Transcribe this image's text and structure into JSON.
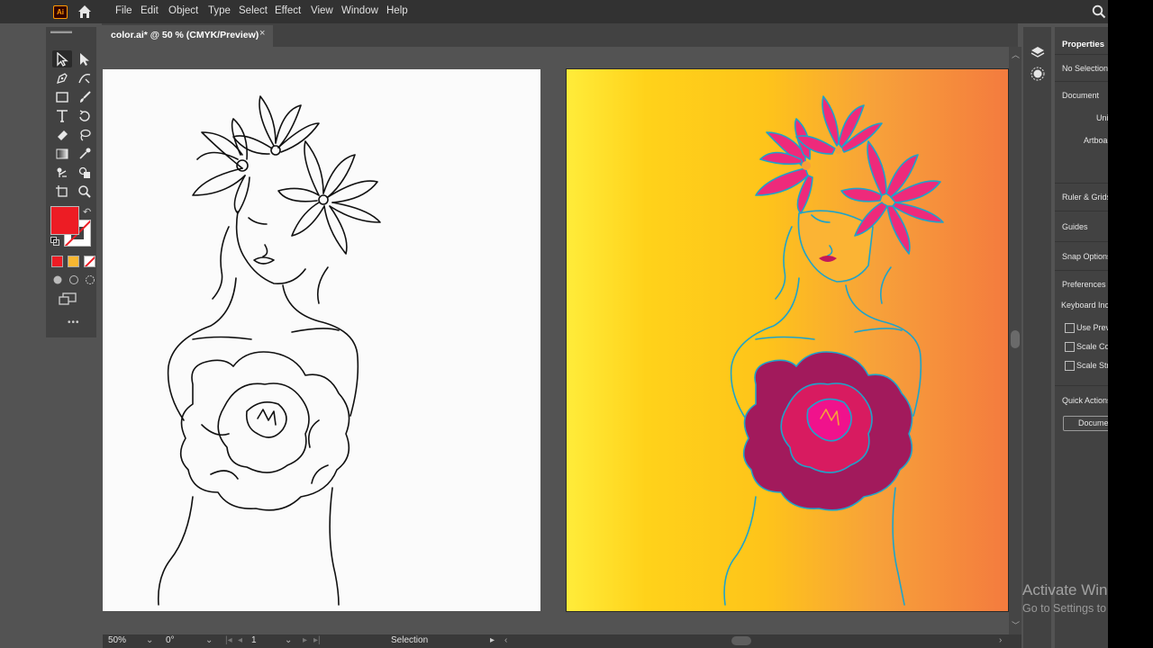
{
  "menubar": {
    "logo_text": "Ai",
    "items": [
      "File",
      "Edit",
      "Object",
      "Type",
      "Select",
      "Effect",
      "View",
      "Window",
      "Help"
    ]
  },
  "document_tab": {
    "title": "color.ai* @ 50 % (CMYK/Preview)",
    "close_glyph": "×"
  },
  "toolbar": {
    "tools": [
      "selection-tool",
      "direct-selection-tool",
      "pen-tool",
      "curvature-tool",
      "rectangle-tool",
      "paintbrush-tool",
      "type-tool",
      "rotate-tool",
      "eraser-tool",
      "lasso-tool",
      "gradient-tool",
      "eyedropper-tool",
      "puppet-warp-tool",
      "shape-builder-tool",
      "artboard-tool",
      "zoom-tool"
    ],
    "fill_color": "#ed1c24",
    "stroke_color": "#ffffff",
    "mode_swatches": [
      "#ed1c24",
      "#f7b731",
      "none"
    ],
    "more_label": "•••"
  },
  "canvas": {
    "left_artboard_bg": "#fbfbfb",
    "right_artboard_gradient": [
      "#ffec3a",
      "#ffd21a",
      "#f7a13a",
      "#f47b3e"
    ],
    "line_art_color": "#111111",
    "colored_outline": "#1fa3c9",
    "flower_pink": "#ee2a7b",
    "rose_crimson": "#a21a5c"
  },
  "statusbar": {
    "zoom": "50%",
    "rotation": "0°",
    "artboard_number": "1",
    "tool_name": "Selection"
  },
  "properties_panel": {
    "title": "Properties",
    "no_selection": "No Selection",
    "document_heading": "Document",
    "units_label": "Uni",
    "artboard_label": "Artboa",
    "ruler_grids": "Ruler & Grids",
    "guides": "Guides",
    "snap_options": "Snap Options",
    "preferences_heading": "Preferences",
    "keyboard_increment": "Keyboard Inc",
    "use_preview": "Use Previ",
    "scale_corners": "Scale Cor",
    "scale_strokes": "Scale Str",
    "quick_actions": "Quick Actions",
    "document_setup_button": "Docume"
  },
  "watermark": {
    "line1": "Activate Win",
    "line2": "Go to Settings to"
  }
}
